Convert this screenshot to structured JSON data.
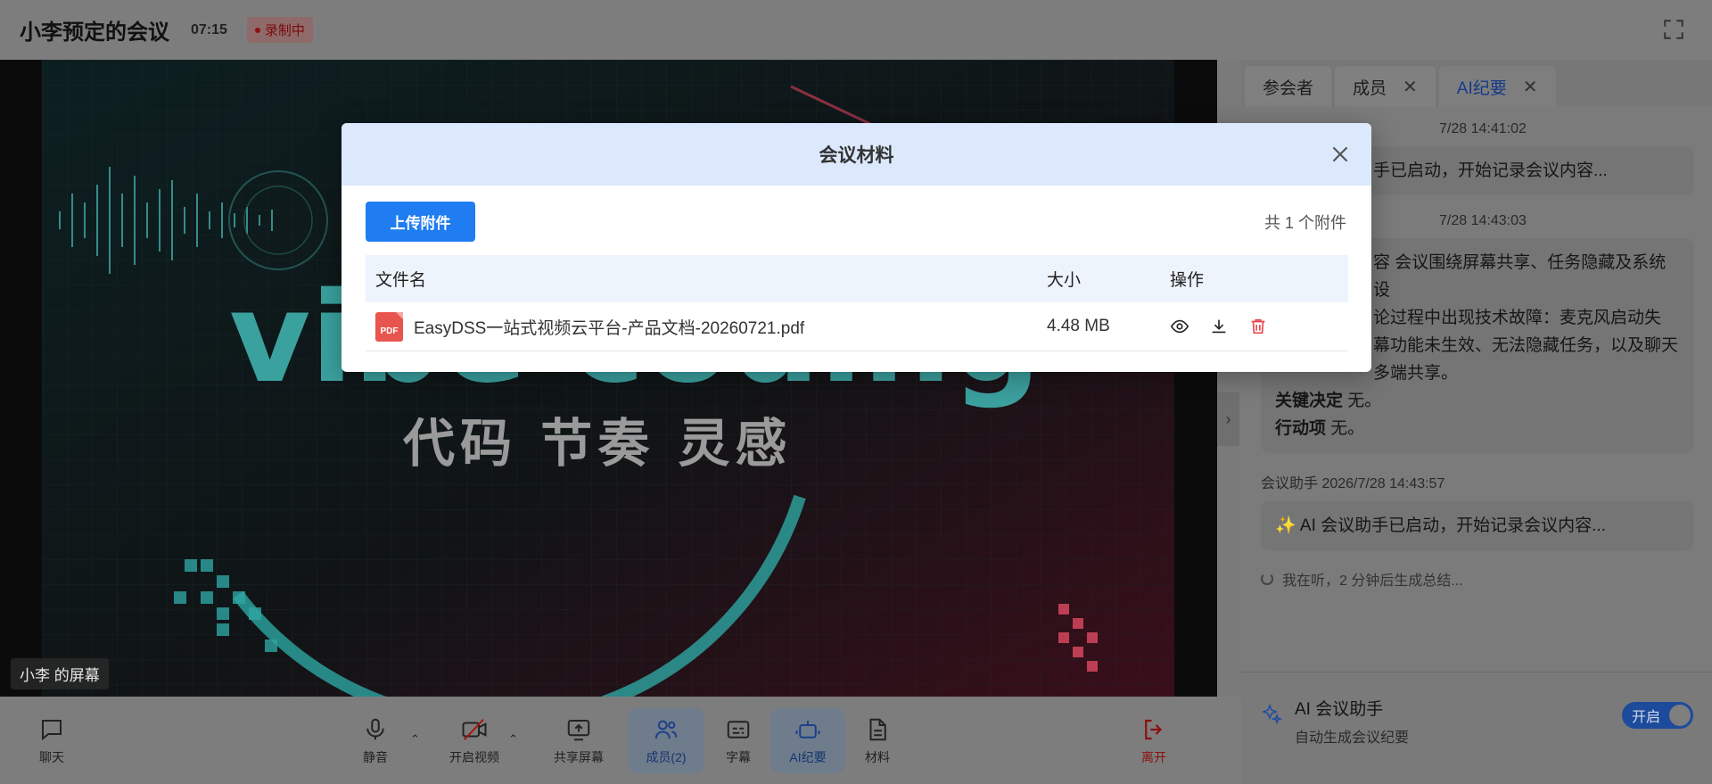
{
  "header": {
    "title": "小李预定的会议",
    "time": "07:15",
    "recording": "录制中",
    "fullscreen_icon": "fullscreen-icon"
  },
  "video": {
    "owner_label": "小李 的屏幕",
    "slide_title": "vibe coding",
    "slide_subtitle": "代码 节奏 灵感"
  },
  "toolbar": {
    "chat": "聊天",
    "mute": "静音",
    "video": "开启视频",
    "share": "共享屏幕",
    "members": "成员(2)",
    "subtitle": "字幕",
    "ai_minutes": "AI纪要",
    "materials": "材料",
    "leave": "离开"
  },
  "panel": {
    "tabs": [
      "参会者",
      "成员",
      "AI纪要"
    ],
    "msg1_meta": "7/28 14:41:02",
    "msg1_text": "手已启动，开始记录会议内容...",
    "msg2_meta": "7/28 14:43:03",
    "msg2_line1": "容 会议围绕屏幕共享、任务隐藏及系统设",
    "msg2_line2": "论过程中出现技术故障：麦克风启动失",
    "msg2_line3": "幕功能未生效、无法隐藏任务，以及聊天",
    "msg2_line4": "多端共享。",
    "decision_label": "关键决定",
    "decision_value": "无。",
    "action_label": "行动项",
    "action_value": "无。",
    "msg3_meta": "会议助手  2026/7/28 14:43:57",
    "msg3_text": "AI 会议助手已启动，开始记录会议内容...",
    "listening": "我在听，2 分钟后生成总结...",
    "assistant_name": "AI 会议助手",
    "assistant_sub": "自动生成会议纪要",
    "toggle_label": "开启"
  },
  "modal": {
    "title": "会议材料",
    "upload_label": "上传附件",
    "count_label": "共 1 个附件",
    "columns": {
      "name": "文件名",
      "size": "大小",
      "ops": "操作"
    },
    "files": [
      {
        "name": "EasyDSS一站式视频云平台-产品文档-20260721.pdf",
        "size": "4.48 MB",
        "type": "PDF"
      }
    ]
  },
  "colors": {
    "accent": "#1f7df1",
    "modal_header": "#dce9fc",
    "table_header": "#eef4fc",
    "delete": "#e5484d",
    "leave": "#8c1010"
  }
}
